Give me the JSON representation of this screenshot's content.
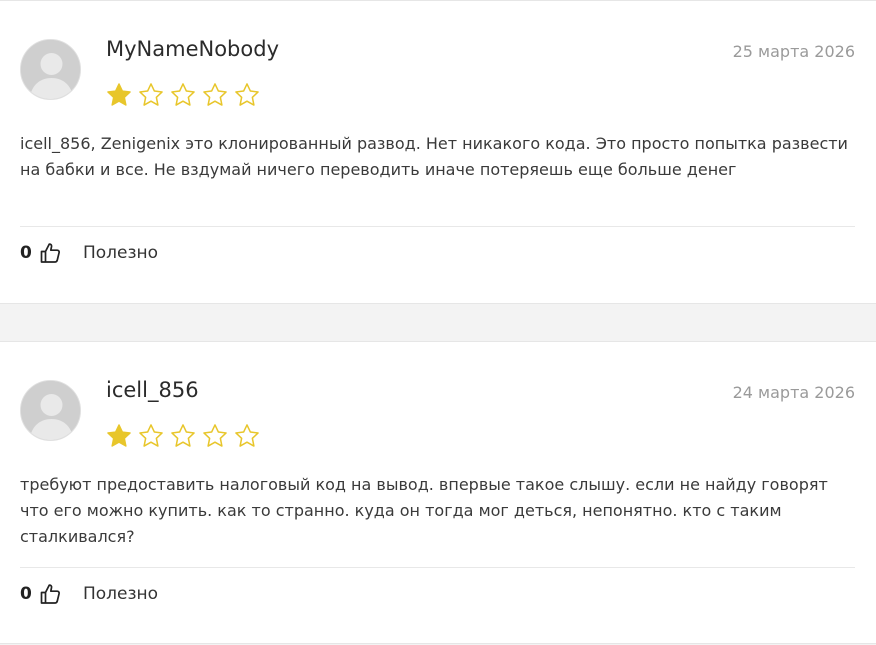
{
  "colors": {
    "star_filled": "#e8c62b",
    "star_outline": "#e8c62b",
    "avatar_bg": "#cfcfcf",
    "date_text": "#9a9a9a"
  },
  "reviews": [
    {
      "author": "MyNameNobody",
      "date": "25 марта 2026",
      "rating": 1,
      "max_rating": 5,
      "text": "icell_856, Zenigenix это клонированный развод. Нет никакого кода. Это просто попытка развести на бабки и все. Не вздумай ничего переводить иначе потеряешь еще больше денег",
      "useful_count": "0",
      "useful_label": "Полезно",
      "avatar_icon": "user-avatar-icon",
      "useful_icon": "thumbs-up-icon"
    },
    {
      "author": "icell_856",
      "date": "24 марта 2026",
      "rating": 1,
      "max_rating": 5,
      "text": "требуют предоставить налоговый код на вывод. впервые такое слышу. если не найду говорят что его можно купить. как то странно. куда он тогда мог деться, непонятно. кто с таким сталкивался?",
      "useful_count": "0",
      "useful_label": "Полезно",
      "avatar_icon": "user-avatar-icon",
      "useful_icon": "thumbs-up-icon"
    }
  ]
}
